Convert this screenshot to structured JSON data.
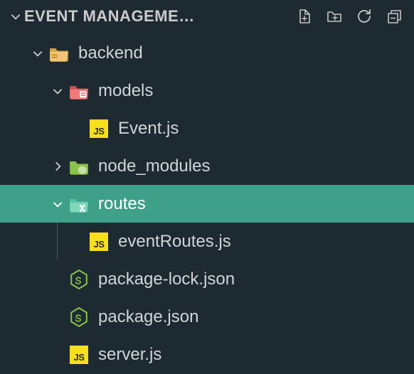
{
  "explorer": {
    "title": "EVENT MANAGEME…"
  },
  "tree": {
    "backend": {
      "label": "backend"
    },
    "models": {
      "label": "models"
    },
    "event_js": {
      "label": "Event.js"
    },
    "node_modules": {
      "label": "node_modules"
    },
    "routes": {
      "label": "routes"
    },
    "event_routes_js": {
      "label": "eventRoutes.js"
    },
    "package_lock": {
      "label": "package-lock.json"
    },
    "package_json": {
      "label": "package.json"
    },
    "server_js": {
      "label": "server.js"
    }
  },
  "icons": {
    "js_badge": "JS"
  }
}
